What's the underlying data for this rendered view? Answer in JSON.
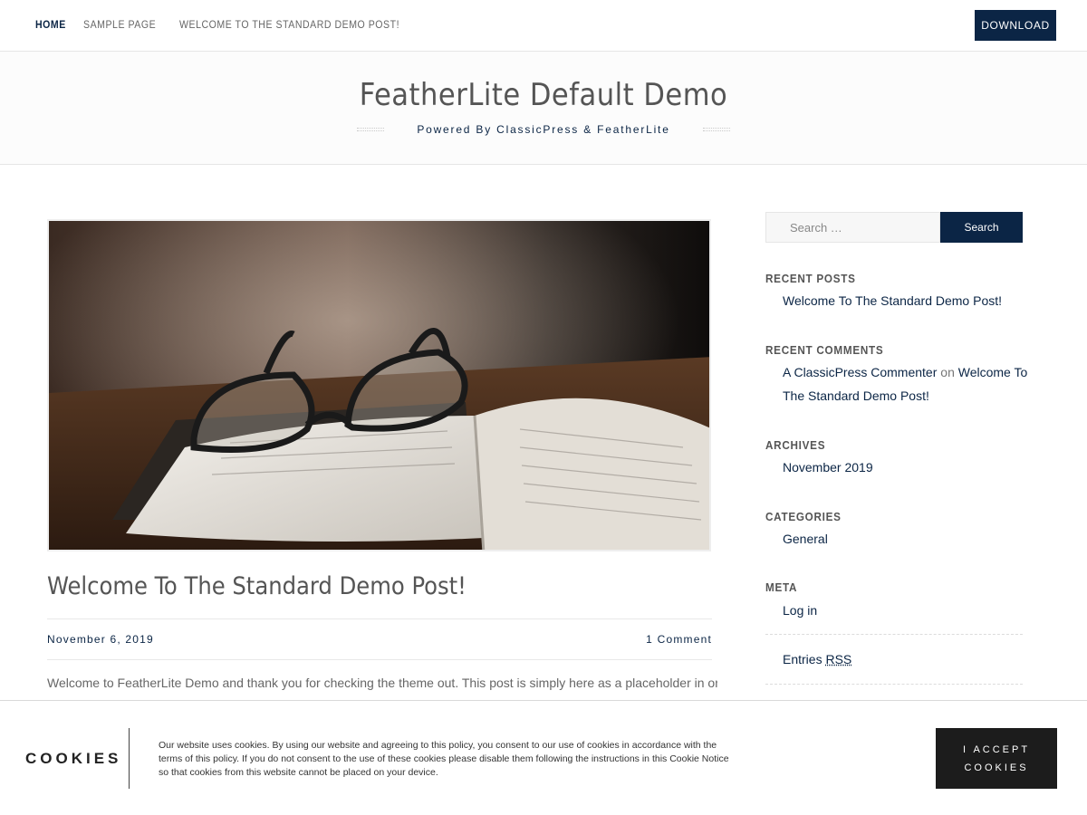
{
  "nav": {
    "links": [
      "Home",
      "Sample Page",
      "Welcome To The Standard Demo Post!"
    ],
    "active_index": 0,
    "download_label": "Download"
  },
  "header": {
    "title": "FeatherLite Default Demo",
    "tagline": "Powered By ClassicPress & FeatherLite"
  },
  "post": {
    "title": "Welcome To The Standard Demo Post!",
    "date": "November 6, 2019",
    "comments": "1 Comment",
    "excerpt": "Welcome to FeatherLite Demo  and thank you for checking the theme out. This post is simply here as a placeholder in order to"
  },
  "sidebar": {
    "search": {
      "placeholder": "Search …",
      "button": "Search"
    },
    "recent_posts": {
      "title": "Recent Posts",
      "items": [
        "Welcome To The Standard Demo Post!"
      ]
    },
    "recent_comments": {
      "title": "Recent Comments",
      "author": "A ClassicPress Commenter",
      "connector": "on",
      "post_line1": "Welcome To",
      "post_line2": "The Standard Demo Post!"
    },
    "archives": {
      "title": "Archives",
      "items": [
        "November 2019"
      ]
    },
    "categories": {
      "title": "Categories",
      "items": [
        "General"
      ]
    },
    "meta": {
      "title": "Meta",
      "login": "Log in",
      "entries": "Entries",
      "rss": "RSS"
    }
  },
  "cookie": {
    "title": "COOKIES",
    "text": "Our website uses cookies. By using our website and agreeing to this policy, you consent to our use of cookies in accordance with the terms of this policy. If you do not consent to the use of these cookies please disable them following the instructions in this Cookie Notice so that cookies from this website cannot be placed on your device.",
    "accept": "I ACCEPT\nCOOKIES"
  },
  "colors": {
    "accent": "#0b2545",
    "cookie_button": "#1c1c1c"
  }
}
